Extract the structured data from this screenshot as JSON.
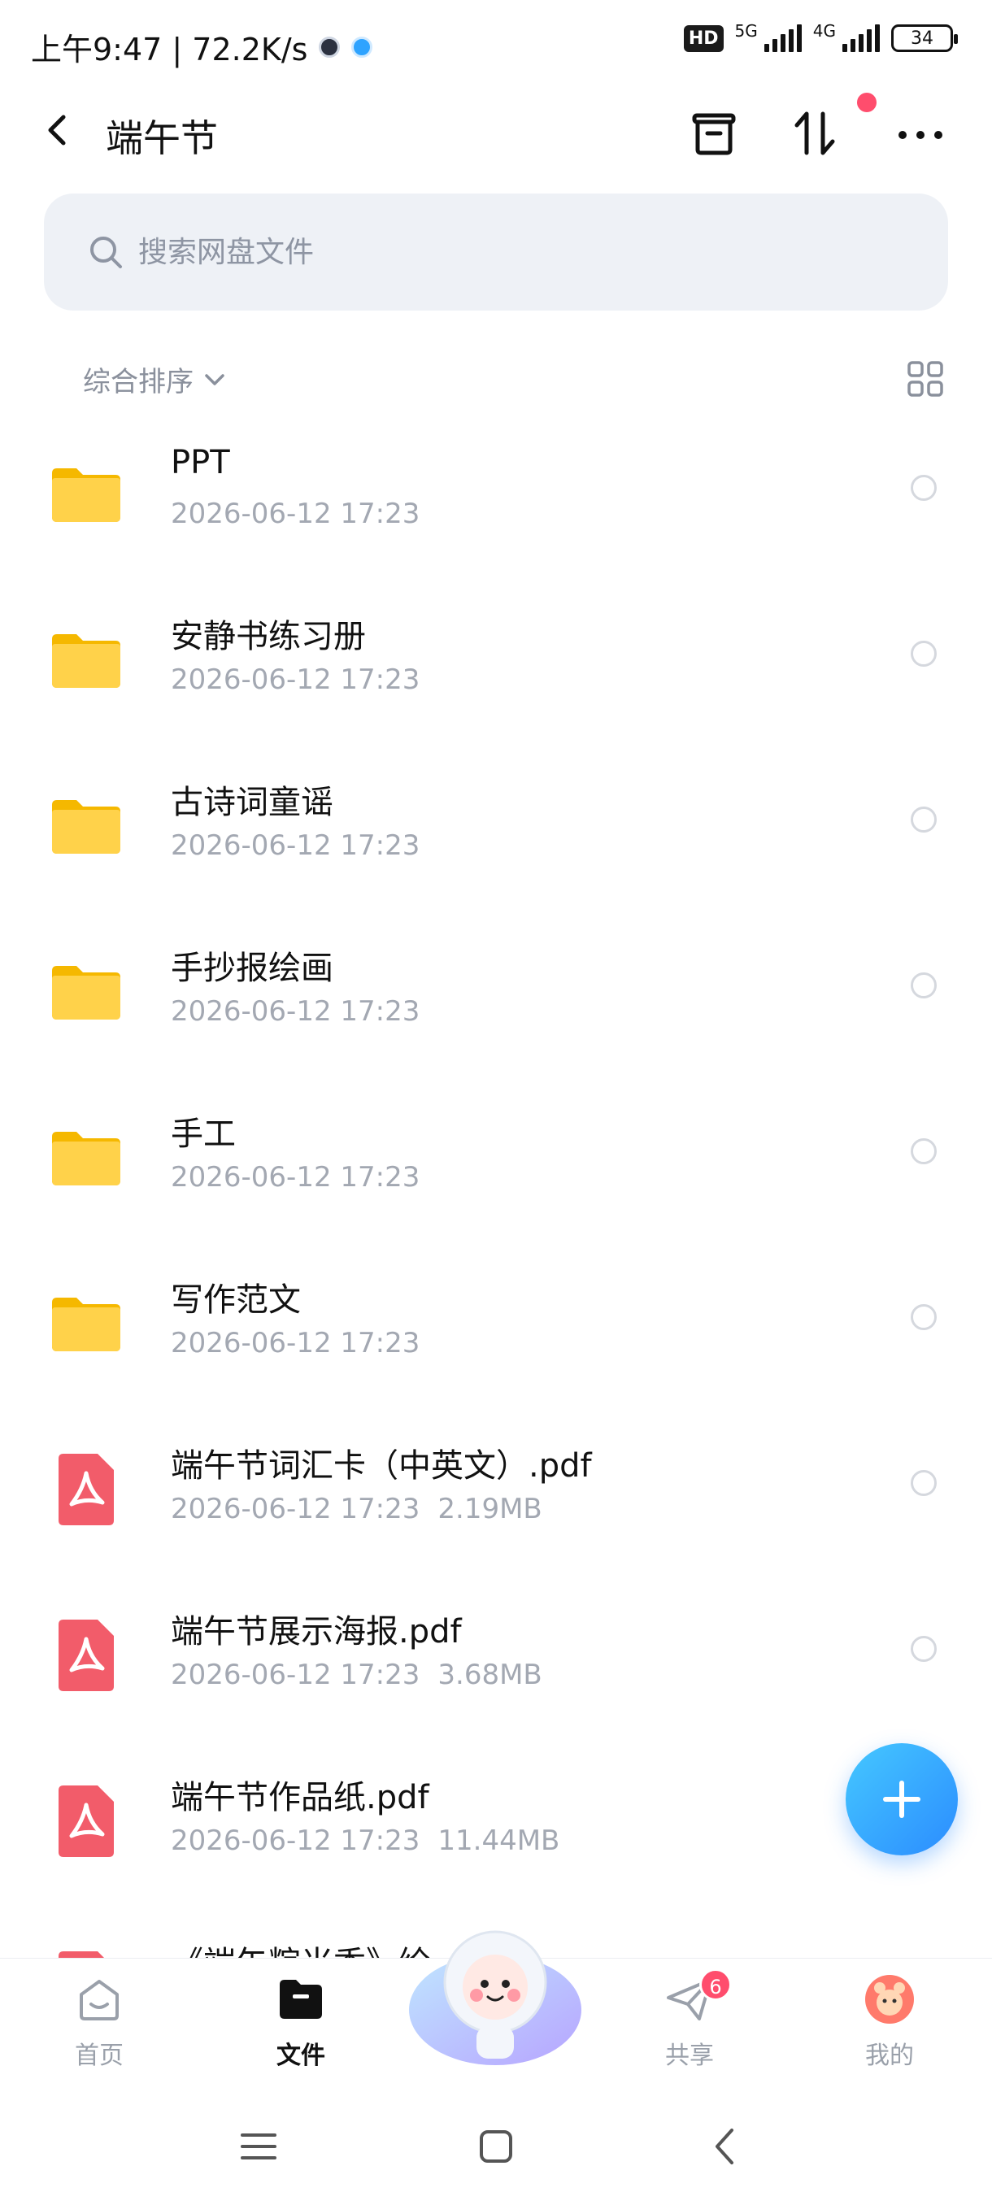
{
  "status_bar": {
    "time_speed": "上午9:47 | 72.2K/s",
    "hd": "HD",
    "net1": "5G",
    "net2": "4G",
    "battery": "34"
  },
  "header": {
    "title": "端午节"
  },
  "search": {
    "placeholder": "搜索网盘文件"
  },
  "sort": {
    "label": "综合排序"
  },
  "files": [
    {
      "name": "PPT",
      "date": "2026-06-12  17:23",
      "size": "",
      "type": "folder"
    },
    {
      "name": "安静书练习册",
      "date": "2026-06-12  17:23",
      "size": "",
      "type": "folder"
    },
    {
      "name": "古诗词童谣",
      "date": "2026-06-12  17:23",
      "size": "",
      "type": "folder"
    },
    {
      "name": "手抄报绘画",
      "date": "2026-06-12  17:23",
      "size": "",
      "type": "folder"
    },
    {
      "name": "手工",
      "date": "2026-06-12  17:23",
      "size": "",
      "type": "folder"
    },
    {
      "name": "写作范文",
      "date": "2026-06-12  17:23",
      "size": "",
      "type": "folder"
    },
    {
      "name": "端午节词汇卡（中英文）.pdf",
      "date": "2026-06-12  17:23",
      "size": "2.19MB",
      "type": "pdf"
    },
    {
      "name": "端午节展示海报.pdf",
      "date": "2026-06-12  17:23",
      "size": "3.68MB",
      "type": "pdf"
    },
    {
      "name": "端午节作品纸.pdf",
      "date": "2026-06-12  17:23",
      "size": "11.44MB",
      "type": "pdf"
    },
    {
      "name": "《端午粽米香》绘",
      "date": "",
      "size": "",
      "type": "pdf"
    }
  ],
  "bottom_nav": {
    "home": "首页",
    "files": "文件",
    "share": "共享",
    "share_badge": "6",
    "mine": "我的"
  },
  "colors": {
    "folder": "#ffd24a",
    "pdf": "#f25c6a",
    "accent": "#2b8cff",
    "badge": "#ff4d6d"
  }
}
